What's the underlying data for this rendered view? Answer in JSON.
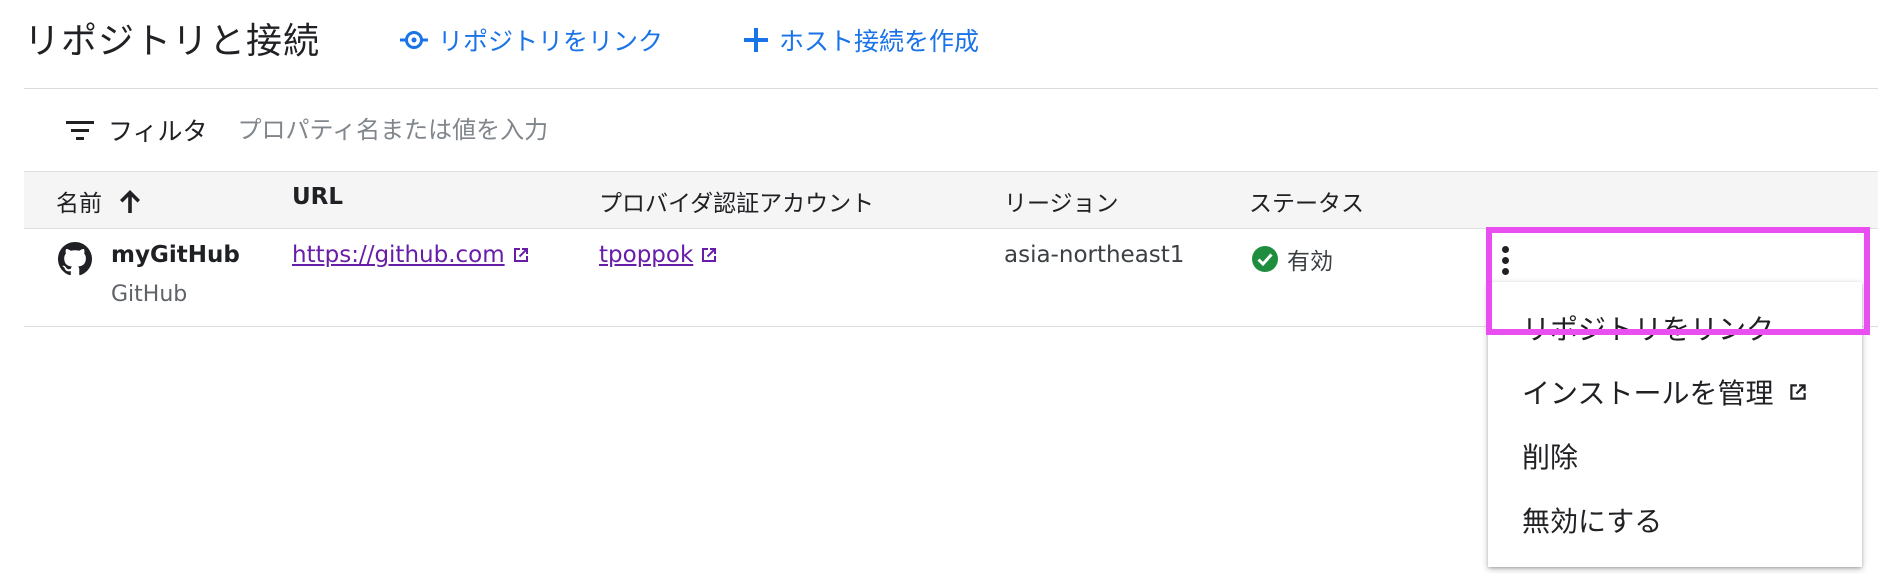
{
  "header": {
    "title": "リポジトリと接続",
    "link_repo_label": "リポジトリをリンク",
    "create_host_label": "ホスト接続を作成"
  },
  "filter": {
    "label": "フィルタ",
    "placeholder": "プロパティ名または値を入力"
  },
  "table": {
    "columns": {
      "name": "名前",
      "url": "URL",
      "account": "プロバイダ認証アカウント",
      "region": "リージョン",
      "status": "ステータス"
    },
    "sort": {
      "column": "name",
      "direction": "ascending"
    },
    "rows": [
      {
        "name": "myGitHub",
        "type": "GitHub",
        "url": "https://github.com",
        "account": "tpoppok",
        "region": "asia-northeast1",
        "status": "有効"
      }
    ]
  },
  "menu": {
    "items": [
      {
        "label": "リポジトリをリンク"
      },
      {
        "label": "インストールを管理"
      },
      {
        "label": "削除"
      },
      {
        "label": "無効にする"
      }
    ]
  },
  "colors": {
    "accent": "#1a73e8",
    "link_visited": "#681da8",
    "status_ok": "#1e8e3e",
    "highlight": "#e84ef0"
  },
  "icons": {
    "link_repo": "link-repo-icon",
    "create": "plus-icon",
    "filter": "filter-icon",
    "sort": "arrow-up-icon",
    "provider": "github-icon",
    "external": "external-link-icon",
    "status": "check-circle-icon",
    "more": "more-vert-icon"
  }
}
